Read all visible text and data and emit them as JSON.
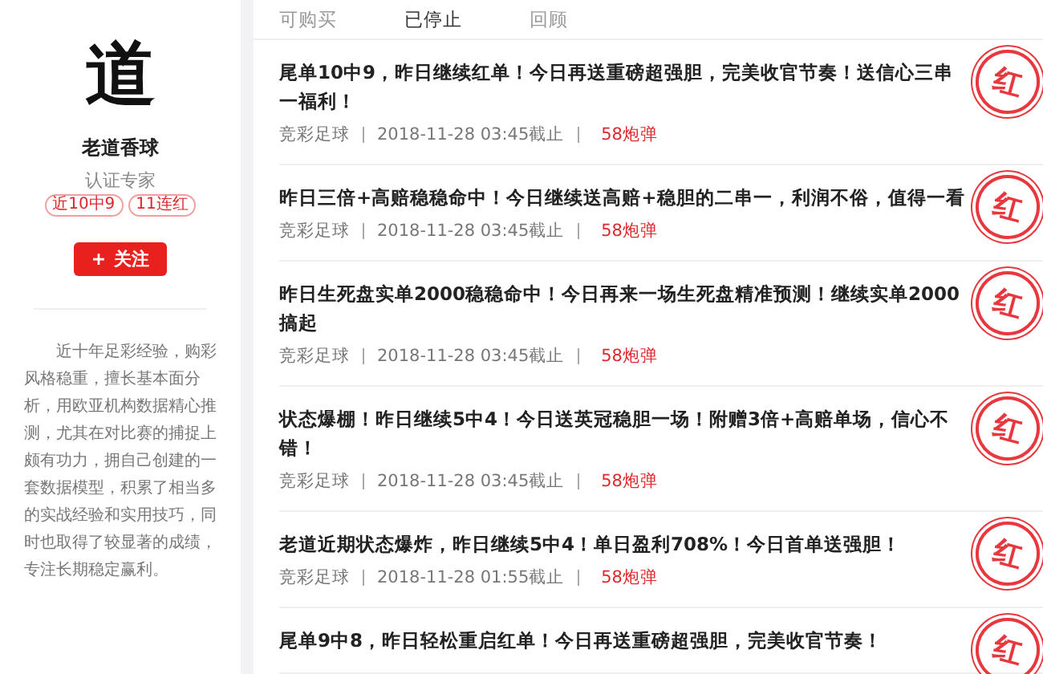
{
  "profile": {
    "avatar_text": "道",
    "name": "老道香球",
    "title": "认证专家",
    "badges": [
      "近10中9",
      "11连红"
    ],
    "follow_button": {
      "icon": "+",
      "label": "关注"
    },
    "bio": "近十年足彩经验，购彩风格稳重，擅长基本面分析，用欧亚机构数据精心推测，尤其在对比赛的捕捉上颇有功力，拥自己创建的一套数据模型，积累了相当多的实战经验和实用技巧，同时也取得了较显著的成绩，专注长期稳定赢利。"
  },
  "tabs": [
    {
      "label": "可购买",
      "selected": false
    },
    {
      "label": "已停止",
      "selected": true
    },
    {
      "label": "回顾",
      "selected": false
    }
  ],
  "posts": [
    {
      "title": "尾单10中9，昨日继续红单！今日再送重磅超强胆，完美收官节奏！送信心三串一福利！",
      "category": "竞彩足球",
      "deadline": "2018-11-28 03:45截止",
      "price": "58炮弹",
      "stamp": "红"
    },
    {
      "title": "昨日三倍+高赔稳稳命中！今日继续送高赔+稳胆的二串一，利润不俗，值得一看",
      "category": "竞彩足球",
      "deadline": "2018-11-28 03:45截止",
      "price": "58炮弹",
      "stamp": "红"
    },
    {
      "title": "昨日生死盘实单2000稳稳命中！今日再来一场生死盘精准预测！继续实单2000搞起",
      "category": "竞彩足球",
      "deadline": "2018-11-28 03:45截止",
      "price": "58炮弹",
      "stamp": "红"
    },
    {
      "title": "状态爆棚！昨日继续5中4！今日送英冠稳胆一场！附赠3倍+高赔单场，信心不错！",
      "category": "竞彩足球",
      "deadline": "2018-11-28 03:45截止",
      "price": "58炮弹",
      "stamp": "红"
    },
    {
      "title": "老道近期状态爆炸，昨日继续5中4！单日盈利708%！今日首单送强胆！",
      "category": "竞彩足球",
      "deadline": "2018-11-28 01:55截止",
      "price": "58炮弹",
      "stamp": "红"
    },
    {
      "title": "尾单9中8，昨日轻松重启红单！今日再送重磅超强胆，完美收官节奏！",
      "stamp": "红"
    }
  ]
}
